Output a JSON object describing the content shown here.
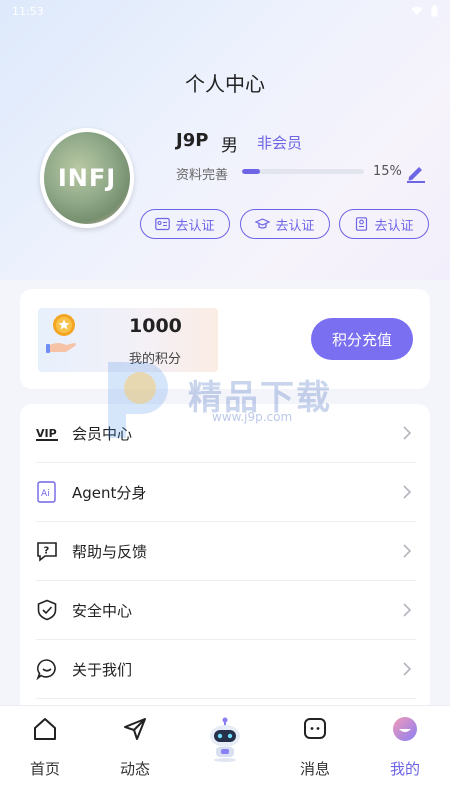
{
  "status_bar": {
    "time": "11:53"
  },
  "page_title": "个人中心",
  "profile": {
    "avatar_text": "INFJ",
    "username": "J9P",
    "gender": "男",
    "member_status": "非会员",
    "completeness_label": "资料完善",
    "completeness_percent": "15%",
    "completeness_value": 0.15,
    "verify_buttons": [
      {
        "label": "去认证",
        "icon": "id-card-icon"
      },
      {
        "label": "去认证",
        "icon": "graduation-cap-icon"
      },
      {
        "label": "去认证",
        "icon": "certificate-icon"
      }
    ]
  },
  "points": {
    "value": "1000",
    "label": "我的积分",
    "recharge_label": "积分充值"
  },
  "menu": {
    "items": [
      {
        "label": "会员中心",
        "icon": "vip-icon"
      },
      {
        "label": "Agent分身",
        "icon": "ai-icon"
      },
      {
        "label": "帮助与反馈",
        "icon": "help-icon"
      },
      {
        "label": "安全中心",
        "icon": "shield-icon"
      },
      {
        "label": "关于我们",
        "icon": "chat-bubble-icon"
      }
    ]
  },
  "watermark": {
    "text": "精品下载",
    "url": "www.j9p.com"
  },
  "tabbar": {
    "items": [
      {
        "label": "首页",
        "icon": "home-icon"
      },
      {
        "label": "动态",
        "icon": "send-icon"
      },
      {
        "label": "",
        "icon": "robot-icon"
      },
      {
        "label": "消息",
        "icon": "message-icon"
      },
      {
        "label": "我的",
        "icon": "profile-icon"
      }
    ],
    "active_index": 4
  },
  "colors": {
    "accent": "#6e64e6",
    "button": "#7a6ff0"
  }
}
